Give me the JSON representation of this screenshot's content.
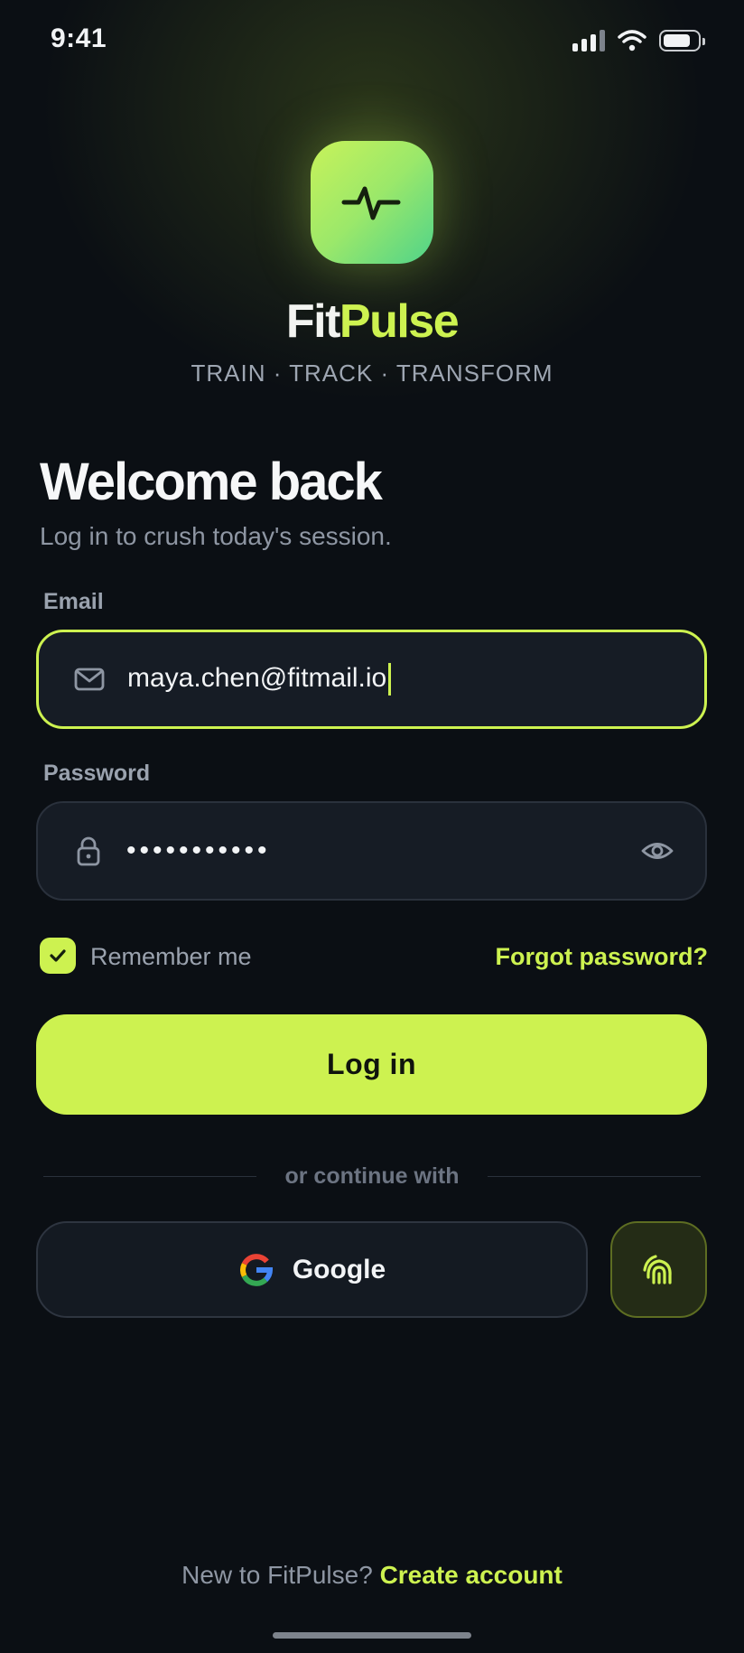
{
  "status_bar": {
    "time": "9:41"
  },
  "brand": {
    "name_part1": "Fit",
    "name_part2": "Pulse",
    "tagline": "TRAIN · TRACK · TRANSFORM"
  },
  "welcome": {
    "title": "Welcome back",
    "subtitle": "Log in to crush today's session."
  },
  "email": {
    "label": "Email",
    "value": "maya.chen@fitmail.io",
    "icon": "mail-icon"
  },
  "password": {
    "label": "Password",
    "masked_value": "•••••••••••",
    "icon": "lock-icon"
  },
  "remember": {
    "label": "Remember me",
    "checked": true
  },
  "forgot": {
    "label": "Forgot password?"
  },
  "login": {
    "label": "Log in"
  },
  "divider": {
    "text": "or continue with"
  },
  "social": {
    "google_label": "Google",
    "biometric_icon": "fingerprint-icon"
  },
  "signup": {
    "prompt": "New to FitPulse?",
    "link": "Create account"
  },
  "colors": {
    "accent": "#cdf250",
    "background": "#0b0f14",
    "field": "#161c25"
  }
}
